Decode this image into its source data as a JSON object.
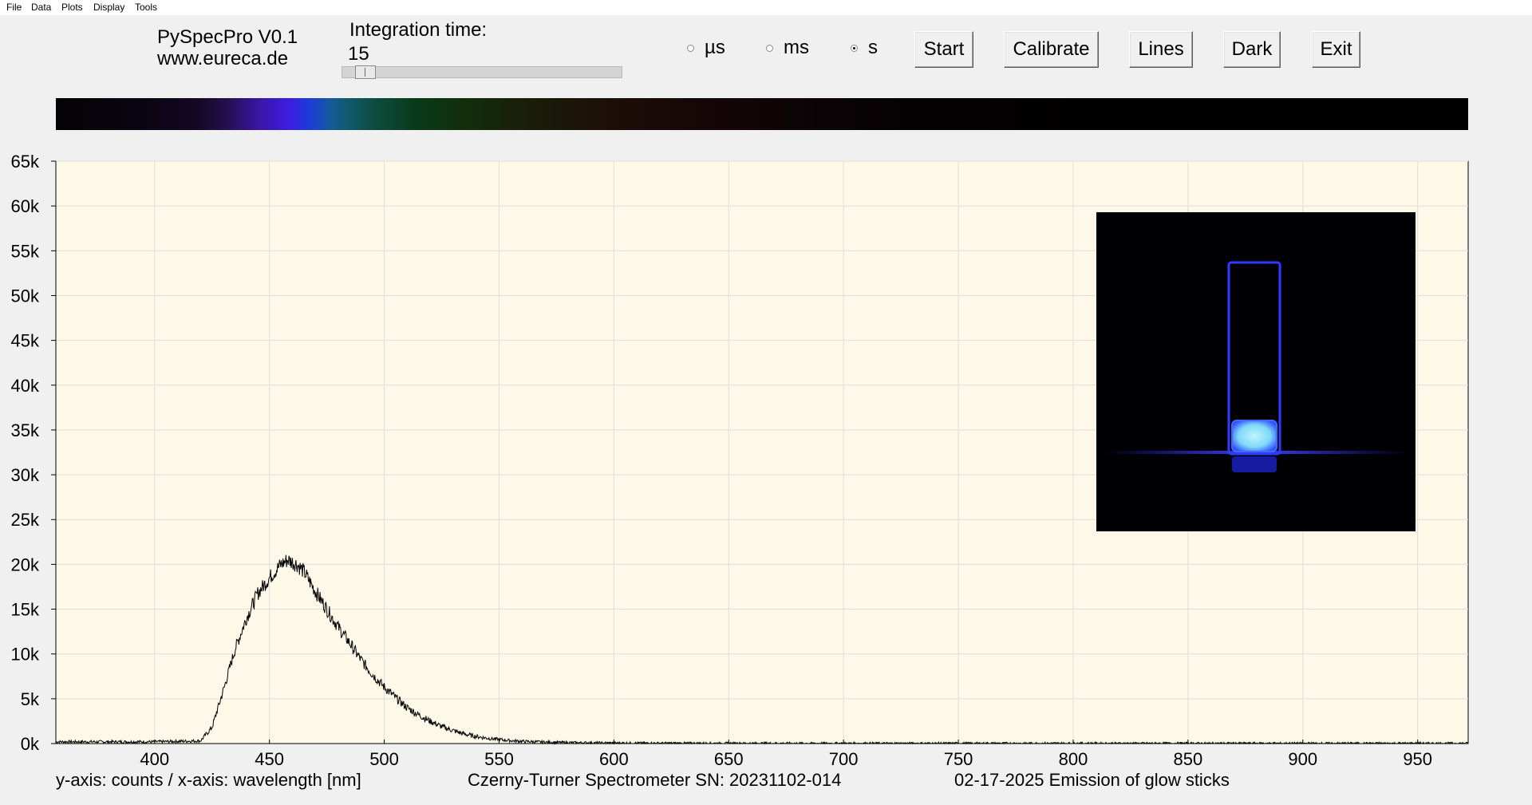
{
  "menu": [
    "File",
    "Data",
    "Plots",
    "Display",
    "Tools"
  ],
  "header": {
    "app_name": "PySpecPro V0.1",
    "website": "www.eureca.de",
    "integration_label": "Integration time:",
    "integration_value": "15",
    "integration_slider_fraction": 0.05
  },
  "units": [
    {
      "label": "µs",
      "selected": false
    },
    {
      "label": "ms",
      "selected": false
    },
    {
      "label": "s",
      "selected": true
    }
  ],
  "buttons": [
    "Start",
    "Calibrate",
    "Lines",
    "Dark",
    "Exit"
  ],
  "footer": {
    "axes_info": "y-axis: counts / x-axis: wavelength [nm]",
    "device": "Czerny-Turner Spectrometer SN: 20231102-014",
    "note": "02-17-2025 Emission of glow sticks"
  },
  "colors": {
    "plot_background": "#fdf8e8",
    "grid": "#dedede",
    "trace": "#000000"
  },
  "chart_data": {
    "type": "line",
    "xlim": [
      357,
      972
    ],
    "ylim": [
      0,
      65000
    ],
    "x_ticks": [
      400,
      450,
      500,
      550,
      600,
      650,
      700,
      750,
      800,
      850,
      900,
      950
    ],
    "x_tick_labels": [
      "400",
      "450",
      "500",
      "550",
      "600",
      "650",
      "700",
      "750",
      "800",
      "850",
      "900",
      "950"
    ],
    "y_ticks": [
      0,
      5000,
      10000,
      15000,
      20000,
      25000,
      30000,
      35000,
      40000,
      45000,
      50000,
      55000,
      60000,
      65000
    ],
    "y_tick_labels": [
      "0k",
      "5k",
      "10k",
      "15k",
      "20k",
      "25k",
      "30k",
      "35k",
      "40k",
      "45k",
      "50k",
      "55k",
      "60k",
      "65k"
    ],
    "grid": true,
    "inset_image": "glowing-cuvette-photo",
    "series": [
      {
        "x": [
          357,
          400,
          420,
          425,
          430,
          435,
          440,
          445,
          450,
          455,
          458,
          462,
          465,
          470,
          475,
          480,
          485,
          490,
          495,
          500,
          505,
          510,
          515,
          520,
          525,
          530,
          535,
          540,
          545,
          550,
          555,
          560,
          570,
          580,
          600,
          620,
          650,
          700,
          750,
          800,
          850,
          900,
          950,
          972
        ],
        "y": [
          200,
          200,
          300,
          1800,
          6000,
          10500,
          14000,
          16800,
          18500,
          20000,
          20500,
          20000,
          19200,
          17000,
          15000,
          13000,
          11200,
          9300,
          7700,
          6300,
          5100,
          4000,
          3200,
          2500,
          1900,
          1450,
          1050,
          800,
          600,
          450,
          330,
          250,
          160,
          110,
          70,
          50,
          40,
          30,
          30,
          30,
          30,
          30,
          30,
          30
        ]
      }
    ]
  }
}
